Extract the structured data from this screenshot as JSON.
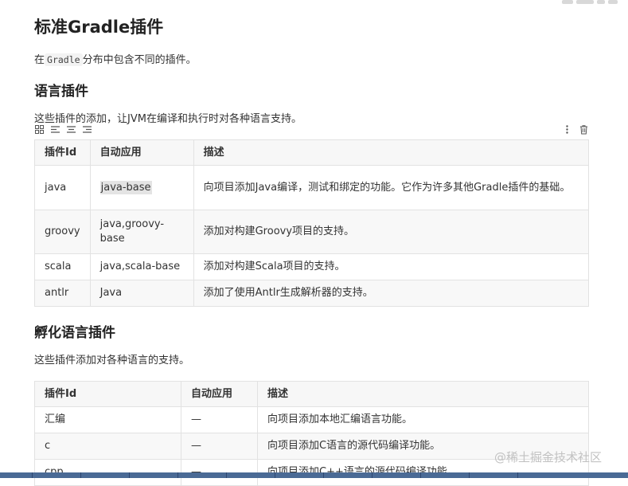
{
  "title": "标准Gradle插件",
  "intro": {
    "prefix": "在",
    "code": "Gradle",
    "suffix": "分布中包含不同的插件。"
  },
  "section1": {
    "heading": "语言插件",
    "desc": "这些插件的添加，让JVM在编译和执行时对各种语言支持。",
    "headers": [
      "插件Id",
      "自动应用",
      "描述"
    ],
    "rows": [
      {
        "id": "java",
        "auto": "java-base",
        "desc": "向项目添加Java编译，测试和绑定的功能。它作为许多其他Gradle插件的基础。"
      },
      {
        "id": "groovy",
        "auto": "java,groovy-base",
        "desc": "添加对构建Groovy项目的支持。"
      },
      {
        "id": "scala",
        "auto": "java,scala-base",
        "desc": "添加对构建Scala项目的支持。"
      },
      {
        "id": "antlr",
        "auto": "Java",
        "desc": "添加了使用Antlr生成解析器的支持。"
      }
    ]
  },
  "section2": {
    "heading": "孵化语言插件",
    "desc": "这些插件添加对各种语言的支持。",
    "headers": [
      "插件Id",
      "自动应用",
      "描述"
    ],
    "rows": [
      {
        "id": "汇编",
        "auto": "—",
        "desc": "向项目添加本地汇编语言功能。"
      },
      {
        "id": "c",
        "auto": "—",
        "desc": "向项目添加C语言的源代码编译功能。"
      },
      {
        "id": "cpp",
        "auto": "—",
        "desc": "向项目添加C++语言的源代码编译功能。"
      }
    ]
  },
  "watermark": "@稀土掘金技术社区",
  "icons": {
    "toolbar_left": [
      "grid-icon",
      "align-left-icon",
      "align-center-icon",
      "align-right-icon"
    ],
    "toolbar_right": [
      "more-vertical-icon",
      "trash-icon"
    ]
  }
}
